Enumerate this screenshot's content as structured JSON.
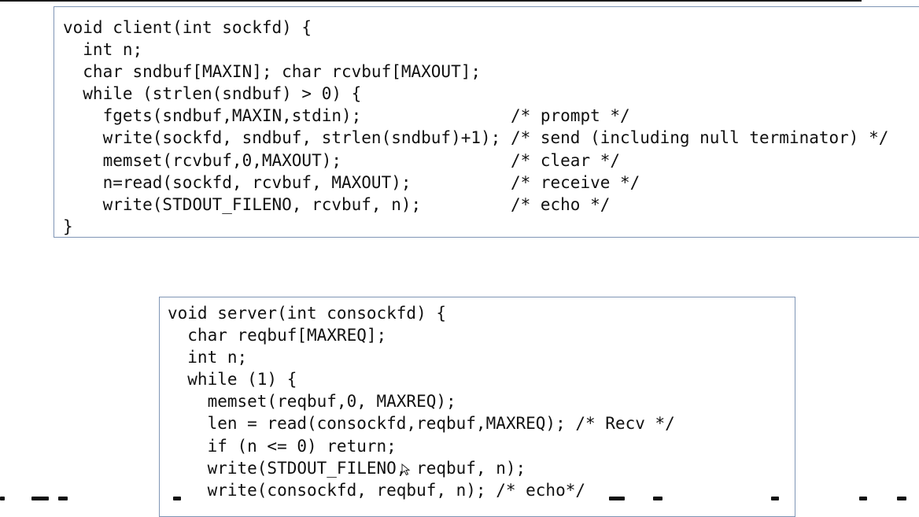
{
  "client_code": {
    "lines": [
      "void client(int sockfd) {",
      "  int n;",
      "  char sndbuf[MAXIN]; char rcvbuf[MAXOUT];",
      "  while (strlen(sndbuf) > 0) {",
      "    fgets(sndbuf,MAXIN,stdin);               /* prompt */",
      "    write(sockfd, sndbuf, strlen(sndbuf)+1); /* send (including null terminator) */",
      "    memset(rcvbuf,0,MAXOUT);                 /* clear */",
      "    n=read(sockfd, rcvbuf, MAXOUT);          /* receive */",
      "    write(STDOUT_FILENO, rcvbuf, n);         /* echo */",
      "}"
    ]
  },
  "server_code": {
    "lines": [
      "void server(int consockfd) {",
      "  char reqbuf[MAXREQ];",
      "  int n;",
      "  while (1) {",
      "    memset(reqbuf,0, MAXREQ);",
      "    len = read(consockfd,reqbuf,MAXREQ); /* Recv */",
      "    if (n <= 0) return;",
      "    write(STDOUT_FILENO, reqbuf, n);",
      "    write(consockfd, reqbuf, n); /* echo*/"
    ]
  },
  "colors": {
    "box_border": "#7f95b5",
    "code_text": "#111111",
    "background": "#ffffff"
  },
  "cursor": {
    "icon": "mouse-pointer-icon"
  }
}
